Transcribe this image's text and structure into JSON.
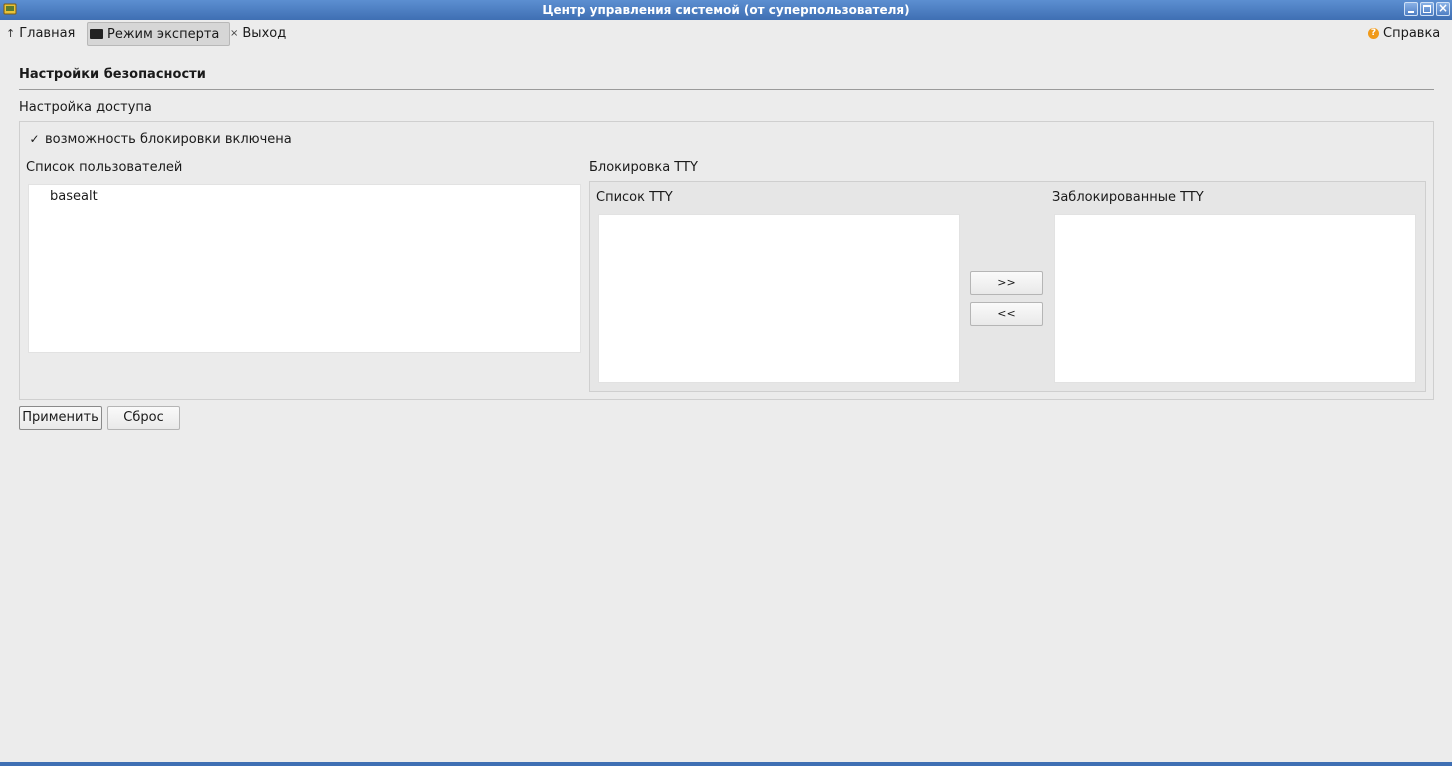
{
  "window": {
    "title": "Центр управления системой (от суперпользователя)"
  },
  "toolbar": {
    "home_label": "Главная",
    "expert_label": "Режим эксперта",
    "exit_label": "Выход",
    "help_label": "Справка"
  },
  "page": {
    "title": "Настройки безопасности",
    "section": "Настройка доступа"
  },
  "lock": {
    "checkbox_label": "возможность блокировки включена",
    "checkbox_checked": true,
    "checkbox_mark": "✓"
  },
  "users": {
    "label": "Список пользователей",
    "items": [
      "basealt"
    ]
  },
  "tty": {
    "group_label": "Блокировка TTY",
    "list_label": "Список TTY",
    "locked_label": "Заблокированные TTY",
    "add_label": ">>",
    "remove_label": "<<"
  },
  "actions": {
    "apply_label": "Применить",
    "reset_label": "Сброс"
  },
  "colors": {
    "titlebar": "#4a7cc0",
    "background": "#ececec",
    "help_icon": "#f09a1a"
  }
}
